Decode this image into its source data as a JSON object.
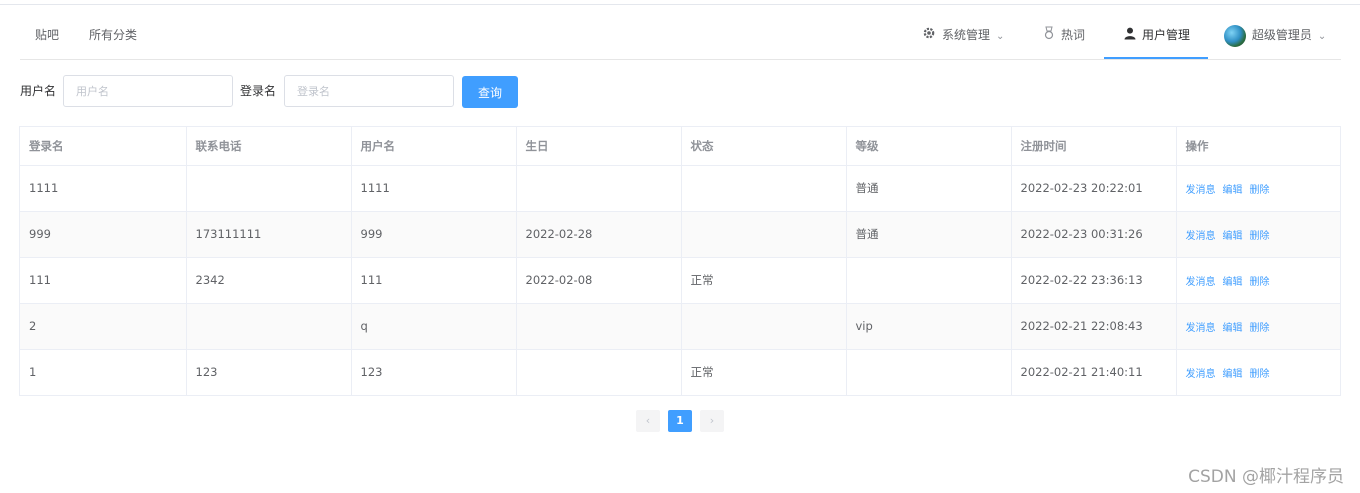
{
  "nav": {
    "left": [
      "贴吧",
      "所有分类"
    ],
    "system_mgmt": "系统管理",
    "hot_words": "热词",
    "user_mgmt": "用户管理",
    "admin": "超级管理员"
  },
  "search": {
    "username_label": "用户名",
    "username_placeholder": "用户名",
    "username_value": "",
    "login_label": "登录名",
    "login_placeholder": "登录名",
    "login_value": "",
    "query_button": "查询"
  },
  "table": {
    "columns": [
      "登录名",
      "联系电话",
      "用户名",
      "生日",
      "状态",
      "等级",
      "注册时间",
      "操作"
    ],
    "rows": [
      [
        "1111",
        "",
        "1111",
        "",
        "",
        "普通",
        "2022-02-23 20:22:01"
      ],
      [
        "999",
        "173111111",
        "999",
        "2022-02-28",
        "",
        "普通",
        "2022-02-23 00:31:26"
      ],
      [
        "111",
        "2342",
        "111",
        "2022-02-08",
        "正常",
        "",
        "2022-02-22 23:36:13"
      ],
      [
        "2",
        "",
        "q",
        "",
        "",
        "vip",
        "2022-02-21 22:08:43"
      ],
      [
        "1",
        "123",
        "123",
        "",
        "正常",
        "",
        "2022-02-21 21:40:11"
      ]
    ],
    "actions": [
      "发消息",
      "编辑",
      "删除"
    ]
  },
  "pagination": {
    "prev": "‹",
    "current": "1",
    "next": "›"
  },
  "watermark": "CSDN @椰汁程序员",
  "colors": {
    "primary": "#409eff",
    "border": "#ebeef5",
    "stripe": "#fafafa"
  }
}
